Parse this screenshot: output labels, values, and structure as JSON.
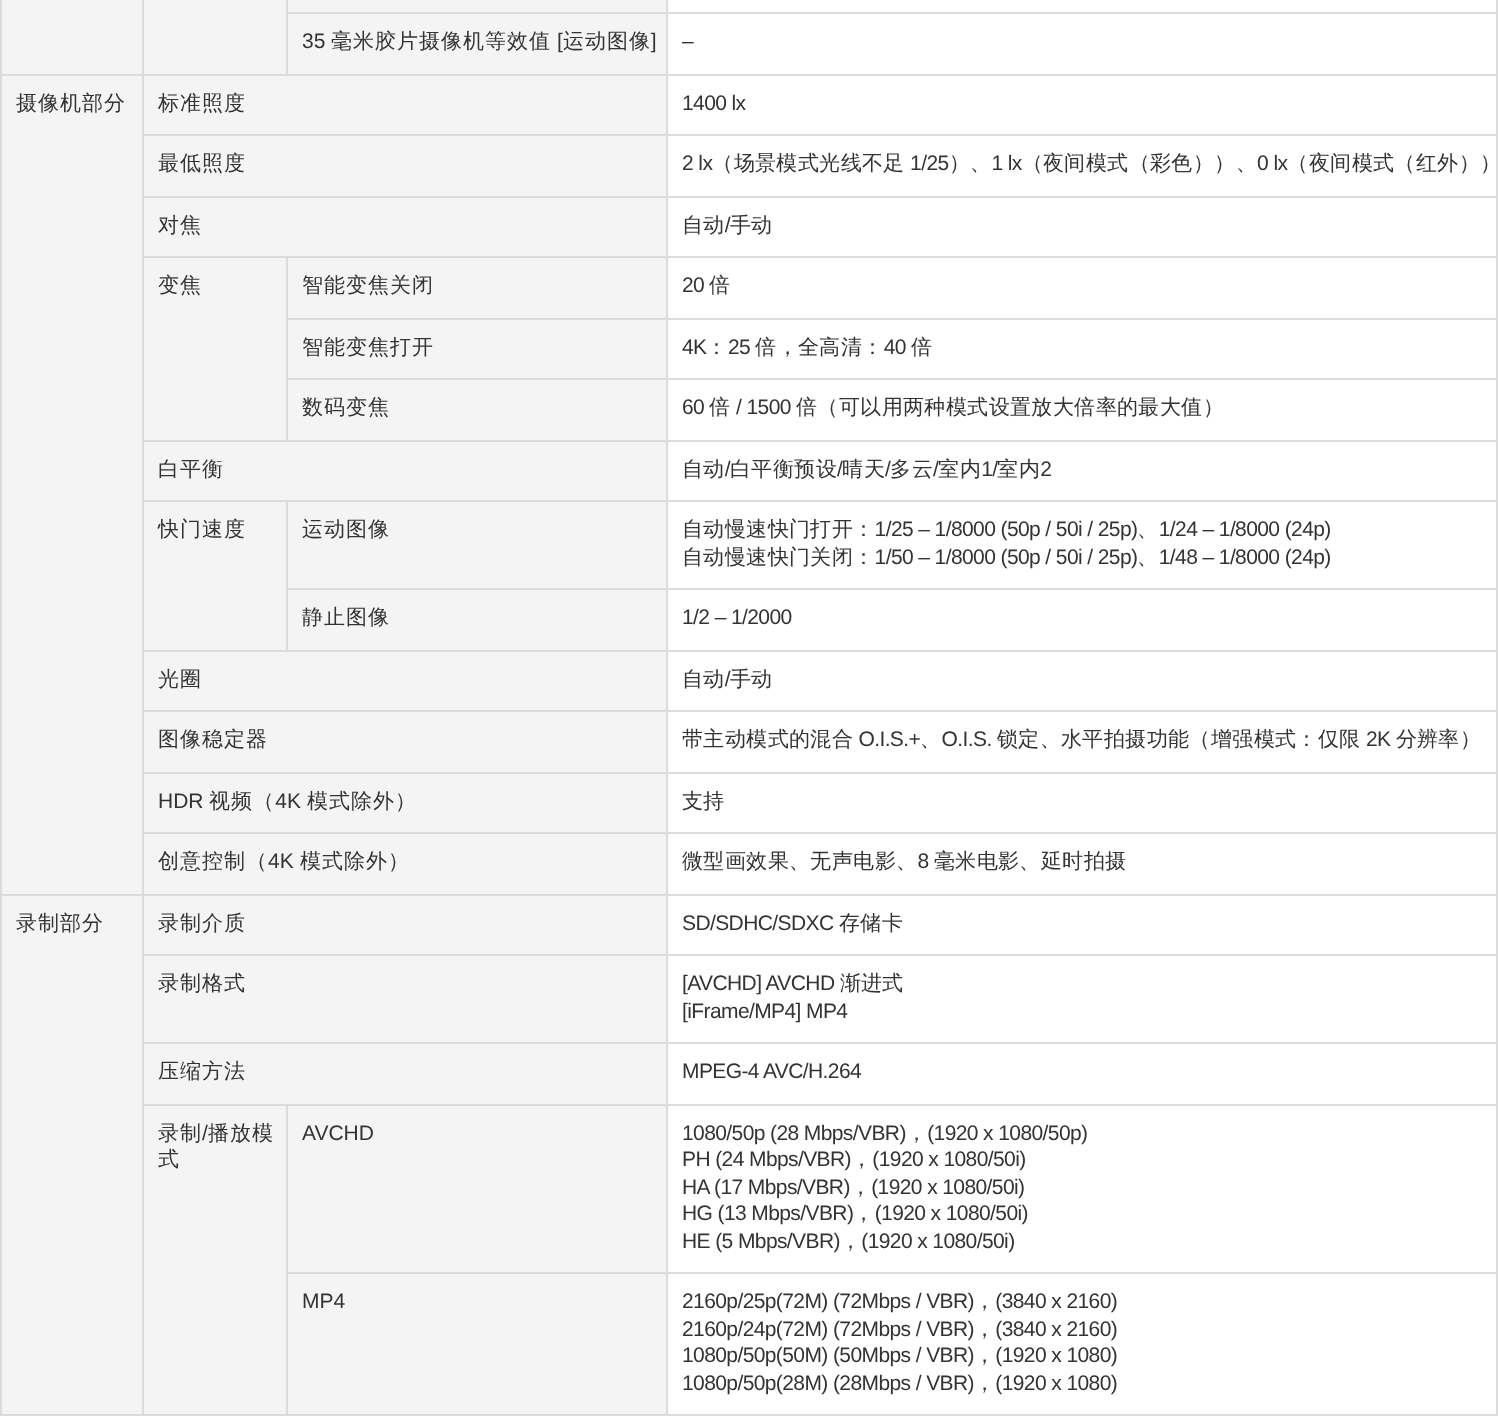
{
  "sections": [
    {
      "items": [
        {
          "children": [
            {
              "label": "35 毫米胶片摄像机等效值 [运动图像]",
              "value": [
                "–"
              ]
            }
          ]
        }
      ]
    },
    {
      "title": "摄像机部分",
      "items": [
        {
          "label": "标准照度",
          "value": [
            "1400 lx"
          ]
        },
        {
          "label": "最低照度",
          "value": [
            "2 lx（场景模式光线不足 1/25）、1 lx（夜间模式（彩色））、0 lx（夜间模式（红外））"
          ]
        },
        {
          "label": "对焦",
          "value": [
            "自动/手动"
          ]
        },
        {
          "label": "变焦",
          "children": [
            {
              "label": "智能变焦关闭",
              "value": [
                "20 倍"
              ]
            },
            {
              "label": "智能变焦打开",
              "value": [
                "4K：25 倍，全高清：40 倍"
              ]
            },
            {
              "label": "数码变焦",
              "value": [
                "60 倍 / 1500 倍（可以用两种模式设置放大倍率的最大值）"
              ]
            }
          ]
        },
        {
          "label": "白平衡",
          "value": [
            "自动/白平衡预设/晴天/多云/室内1/室内2"
          ]
        },
        {
          "label": "快门速度",
          "children": [
            {
              "label": "运动图像",
              "value": [
                "自动慢速快门打开：1/25 – 1/8000 (50p / 50i / 25p)、1/24 – 1/8000 (24p)",
                "自动慢速快门关闭：1/50 – 1/8000 (50p / 50i / 25p)、1/48 – 1/8000 (24p)"
              ]
            },
            {
              "label": "静止图像",
              "value": [
                "1/2 – 1/2000"
              ]
            }
          ]
        },
        {
          "label": "光圈",
          "value": [
            "自动/手动"
          ]
        },
        {
          "label": "图像稳定器",
          "value": [
            "带主动模式的混合 O.I.S.+、O.I.S. 锁定、水平拍摄功能（增强模式：仅限 2K 分辨率）"
          ]
        },
        {
          "label": "HDR 视频（4K 模式除外）",
          "value": [
            "支持"
          ]
        },
        {
          "label": "创意控制（4K 模式除外）",
          "value": [
            "微型画效果、无声电影、8 毫米电影、延时拍摄"
          ]
        }
      ]
    },
    {
      "title": "录制部分",
      "items": [
        {
          "label": "录制介质",
          "value": [
            "SD/SDHC/SDXC 存储卡"
          ]
        },
        {
          "label": "录制格式",
          "value": [
            "[AVCHD] AVCHD 渐进式",
            "[iFrame/MP4] MP4"
          ]
        },
        {
          "label": "压缩方法",
          "value": [
            "MPEG-4 AVC/H.264"
          ]
        },
        {
          "label": "录制/播放模式",
          "children": [
            {
              "label": "AVCHD",
              "value": [
                "1080/50p (28 Mbps/VBR)，(1920 x 1080/50p)",
                "PH (24 Mbps/VBR)，(1920 x 1080/50i)",
                "HA (17 Mbps/VBR)，(1920 x 1080/50i)",
                "HG (13 Mbps/VBR)，(1920 x 1080/50i)",
                "HE (5 Mbps/VBR)，(1920 x 1080/50i)"
              ]
            },
            {
              "label": "MP4",
              "value": [
                "2160p/25p(72M) (72Mbps / VBR)，(3840 x 2160)",
                "2160p/24p(72M) (72Mbps / VBR)，(3840 x 2160)",
                "1080p/50p(50M) (50Mbps / VBR)，(1920 x 1080)",
                "1080p/50p(28M) (28Mbps / VBR)，(1920 x 1080)"
              ]
            }
          ]
        }
      ]
    }
  ]
}
